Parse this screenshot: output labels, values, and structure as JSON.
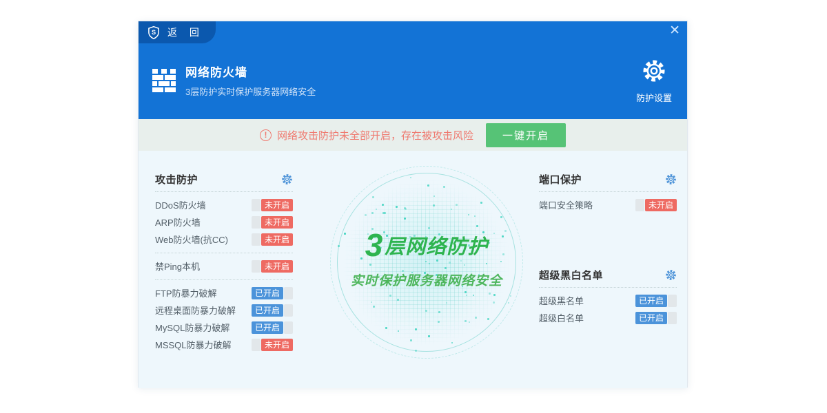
{
  "window": {
    "back_label": "返 回",
    "logo_letter": "S",
    "close_glyph": "✕"
  },
  "header": {
    "title": "网络防火墙",
    "subtitle": "3层防护实时保护服务器网络安全",
    "settings_label": "防护设置"
  },
  "alert": {
    "icon_glyph": "!",
    "message": "网络攻击防护未全部开启，存在被攻击风险",
    "button_label": "一键开启"
  },
  "center": {
    "headline_prefix": "3",
    "headline_rest": "层网络防护",
    "subline": "实时保护服务器网络安全"
  },
  "status_labels": {
    "on": "已开启",
    "off": "未开启"
  },
  "sections": {
    "attack": {
      "title": "攻击防护"
    },
    "port": {
      "title": "端口保护"
    },
    "blackwhite": {
      "title": "超级黑白名单"
    }
  },
  "lists": {
    "attack_group1": [
      {
        "label": "DDoS防火墙",
        "on": false
      },
      {
        "label": "ARP防火墙",
        "on": false
      },
      {
        "label": "Web防火墙(抗CC)",
        "on": false
      }
    ],
    "attack_group2": [
      {
        "label": "禁Ping本机",
        "on": false
      }
    ],
    "attack_group3": [
      {
        "label": "FTP防暴力破解",
        "on": true
      },
      {
        "label": "远程桌面防暴力破解",
        "on": true
      },
      {
        "label": "MySQL防暴力破解",
        "on": true
      },
      {
        "label": "MSSQL防暴力破解",
        "on": false
      }
    ],
    "port_items": [
      {
        "label": "端口安全策略",
        "on": false
      }
    ],
    "blackwhite_items": [
      {
        "label": "超级黑名单",
        "on": true
      },
      {
        "label": "超级白名单",
        "on": true
      }
    ]
  },
  "colors": {
    "header_blue": "#1373d6",
    "tab_blue": "#0b58ae",
    "alert_red": "#ef7a70",
    "button_green": "#56c376",
    "toggle_on_blue": "#4b93da",
    "toggle_off_red": "#ee6a62",
    "globe_teal": "#37d2bd",
    "headline_green": "#2eb44f"
  }
}
